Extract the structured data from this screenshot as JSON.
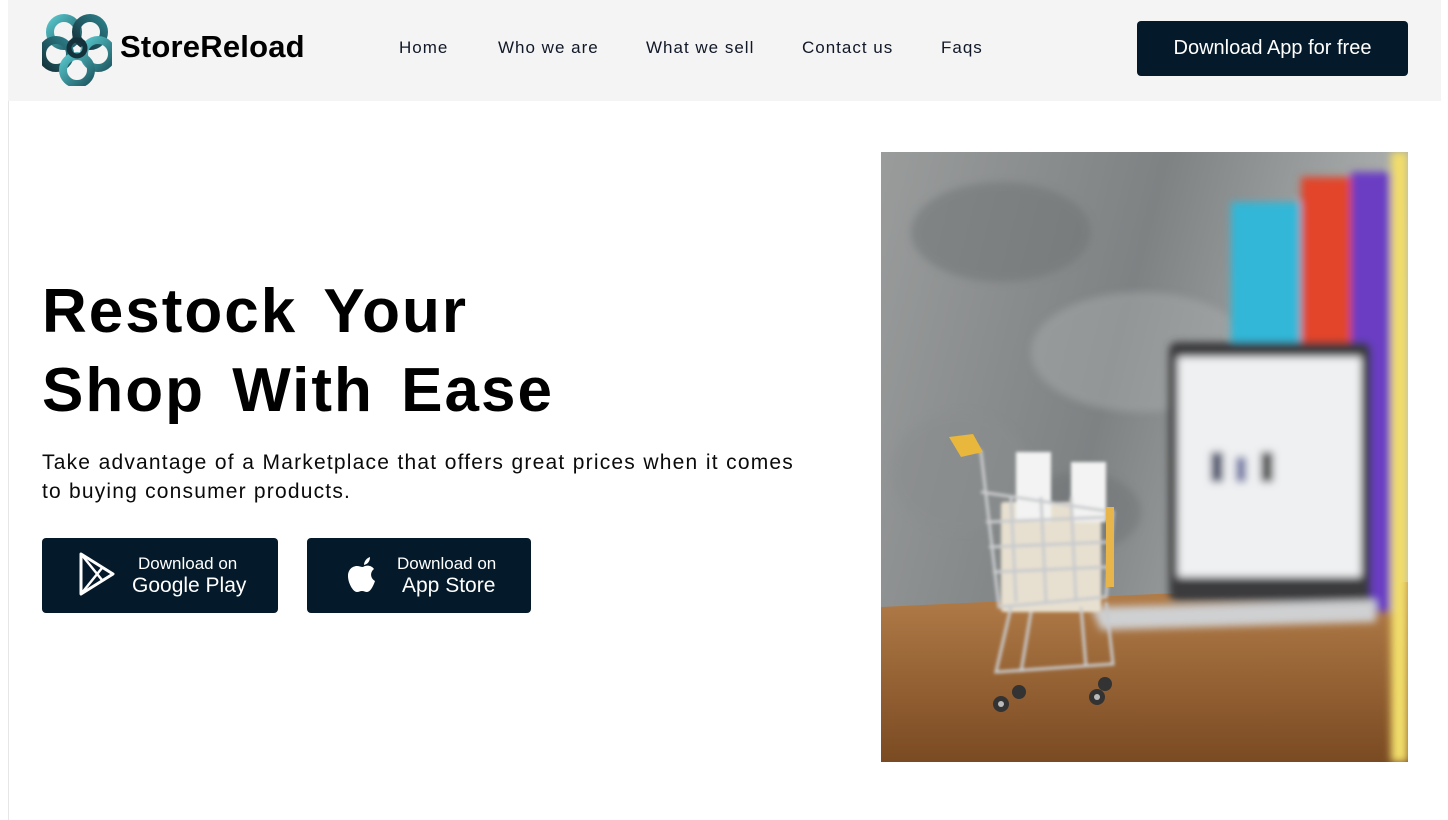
{
  "brand": {
    "name": "StoreReload",
    "logo_icon": "knot-logo-icon"
  },
  "nav": {
    "items": [
      "Home",
      "Who we are",
      "What we sell",
      "Contact us",
      "Faqs"
    ]
  },
  "header": {
    "cta_label": "Download App for free"
  },
  "hero": {
    "title_line1": "Restock Your",
    "title_line2": "Shop With Ease",
    "subtitle": "Take advantage of a Marketplace that offers great prices when it comes to buying consumer products.",
    "google_play": {
      "small": "Download on",
      "big": "Google Play",
      "icon": "google-play-icon"
    },
    "app_store": {
      "small": "Download on",
      "big": "App Store",
      "icon": "apple-icon"
    },
    "image": "shopping-cart-laptop-photo"
  },
  "colors": {
    "header_bg": "#f4f4f4",
    "accent_dark": "#041929",
    "logo_teal": "#3aa6b0"
  }
}
